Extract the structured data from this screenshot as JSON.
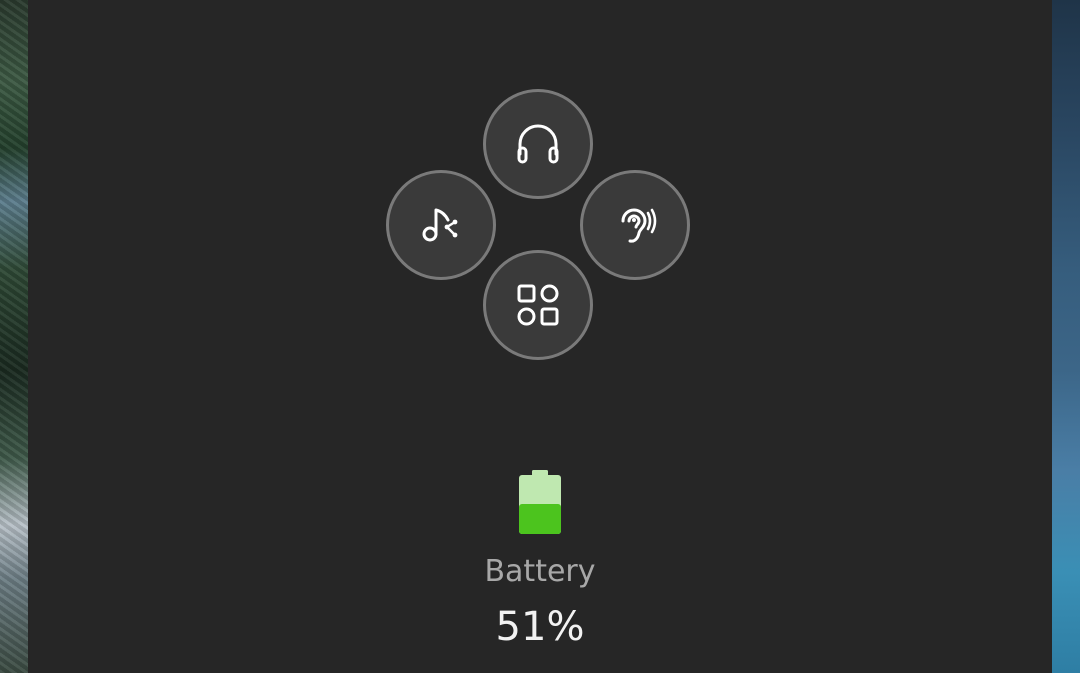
{
  "controls": [
    {
      "id": "headphones",
      "icon": "headphones-icon"
    },
    {
      "id": "music-share",
      "icon": "music-share-icon"
    },
    {
      "id": "hearing",
      "icon": "ear-icon"
    },
    {
      "id": "apps",
      "icon": "apps-grid-icon"
    }
  ],
  "battery": {
    "label": "Battery",
    "value_text": "51%",
    "level": 51,
    "fill_color": "#4cc41e",
    "empty_color": "#bfe8b0"
  },
  "colors": {
    "panel_bg": "#262626",
    "button_bg": "#3a3a3a",
    "button_border": "#7a7a7a",
    "icon_stroke": "#ffffff"
  }
}
